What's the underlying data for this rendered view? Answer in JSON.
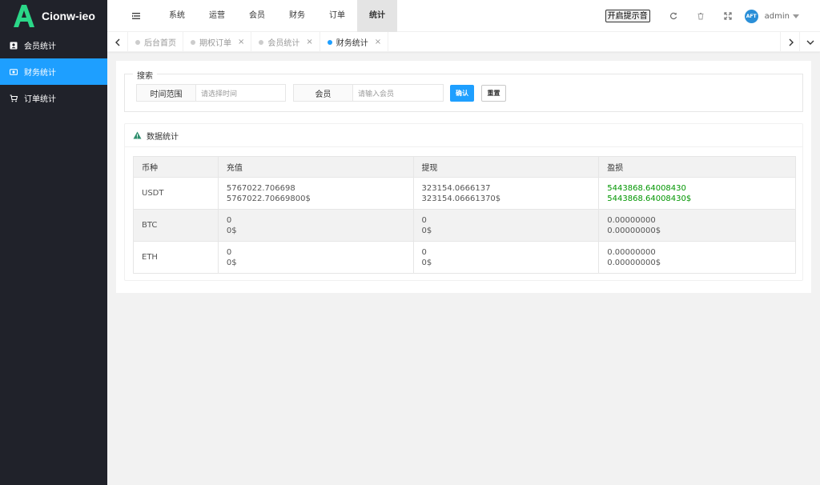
{
  "app": {
    "name": "Cionw-ieo",
    "logo_letter": "A",
    "accent": "#1e9fff",
    "logo_color": "#2bd788"
  },
  "sidebar": {
    "items": [
      {
        "label": "会员统计",
        "icon": "user-card-icon",
        "active": false
      },
      {
        "label": "财务统计",
        "icon": "money-icon",
        "active": true
      },
      {
        "label": "订单统计",
        "icon": "cart-icon",
        "active": false
      }
    ]
  },
  "header": {
    "nav": [
      "系统",
      "运营",
      "会员",
      "财务",
      "订单",
      "统计"
    ],
    "active_nav": "统计",
    "hint_button": "开启提示音",
    "avatar_text": "AFT",
    "user": "admin"
  },
  "tabs": [
    {
      "label": "后台首页",
      "closable": false,
      "active": false
    },
    {
      "label": "期权订单",
      "closable": true,
      "active": false
    },
    {
      "label": "会员统计",
      "closable": true,
      "active": false
    },
    {
      "label": "财务统计",
      "closable": true,
      "active": true
    }
  ],
  "search": {
    "legend": "搜索",
    "time_label": "时间范围",
    "time_placeholder": "请选择时间",
    "member_label": "会员",
    "member_placeholder": "请输入会员",
    "confirm": "确认",
    "reset": "重置"
  },
  "stats": {
    "title": "数据统计",
    "columns": [
      "币种",
      "充值",
      "提现",
      "盈损"
    ],
    "rows": [
      {
        "coin": "USDT",
        "deposit": [
          "5767022.706698",
          "5767022.70669800$"
        ],
        "withdraw": [
          "323154.0666137",
          "323154.06661370$"
        ],
        "profit": [
          "5443868.64008430",
          "5443868.64008430$"
        ],
        "profit_positive": true
      },
      {
        "coin": "BTC",
        "deposit": [
          "0",
          "0$"
        ],
        "withdraw": [
          "0",
          "0$"
        ],
        "profit": [
          "0.00000000",
          "0.00000000$"
        ],
        "profit_positive": false
      },
      {
        "coin": "ETH",
        "deposit": [
          "0",
          "0$"
        ],
        "withdraw": [
          "0",
          "0$"
        ],
        "profit": [
          "0.00000000",
          "0.00000000$"
        ],
        "profit_positive": false
      }
    ]
  }
}
